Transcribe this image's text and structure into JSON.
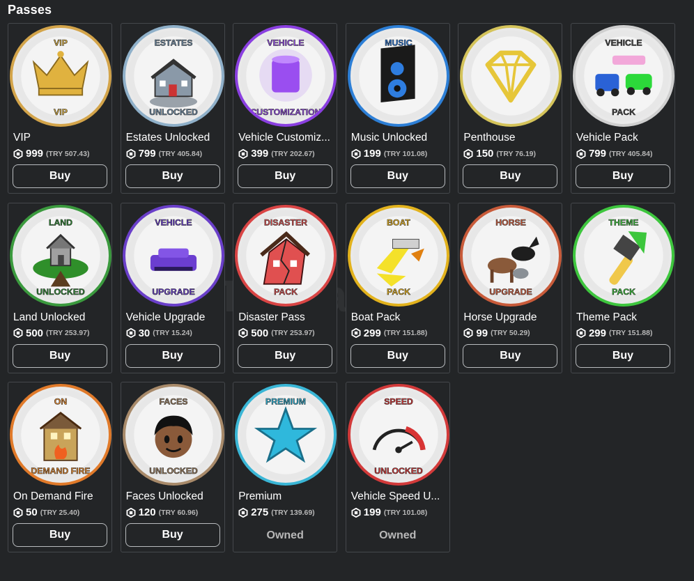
{
  "header": {
    "title": "Passes"
  },
  "watermark": "Tenyaa",
  "passes": [
    {
      "name": "VIP",
      "price": "999",
      "try": "(TRY 507.43)",
      "action": "Buy",
      "icon": "crown-icon",
      "banner_top": "VIP",
      "banner_bottom": "VIP",
      "ring": "#d3a44a",
      "color": "#e0b23f"
    },
    {
      "name": "Estates Unlocked",
      "price": "799",
      "try": "(TRY 405.84)",
      "action": "Buy",
      "icon": "house-icon",
      "banner_top": "ESTATES",
      "banner_bottom": "UNLOCKED",
      "ring": "#8fb0c9",
      "color": "#6f8ca6"
    },
    {
      "name": "Vehicle Customiz...",
      "price": "399",
      "try": "(TRY 202.67)",
      "action": "Buy",
      "icon": "paint-can-icon",
      "banner_top": "VEHICLE",
      "banner_bottom": "CUSTOMIZATION",
      "ring": "#8a3fe0",
      "color": "#9b4ef0"
    },
    {
      "name": "Music Unlocked",
      "price": "199",
      "try": "(TRY 101.08)",
      "action": "Buy",
      "icon": "speaker-icon",
      "banner_top": "MUSIC",
      "banner_bottom": "",
      "ring": "#2d7fd6",
      "color": "#2e7de0"
    },
    {
      "name": "Penthouse",
      "price": "150",
      "try": "(TRY 76.19)",
      "action": "Buy",
      "icon": "diamond-icon",
      "banner_top": "",
      "banner_bottom": "",
      "ring": "#d4c35a",
      "color": "#e6c639"
    },
    {
      "name": "Vehicle Pack",
      "price": "799",
      "try": "(TRY 405.84)",
      "action": "Buy",
      "icon": "cars-icon",
      "banner_top": "VEHICLE",
      "banner_bottom": "PACK",
      "ring": "#cfcfcf",
      "color": "#444444"
    },
    {
      "name": "Land Unlocked",
      "price": "500",
      "try": "(TRY 253.97)",
      "action": "Buy",
      "icon": "island-house-icon",
      "banner_top": "LAND",
      "banner_bottom": "UNLOCKED",
      "ring": "#3b9a3e",
      "color": "#2f8a34"
    },
    {
      "name": "Vehicle Upgrade",
      "price": "30",
      "try": "(TRY 15.24)",
      "action": "Buy",
      "icon": "car-upgrade-icon",
      "banner_top": "VEHICLE",
      "banner_bottom": "UPGRADE",
      "ring": "#6a3fc9",
      "color": "#6b3ed0"
    },
    {
      "name": "Disaster Pass",
      "price": "500",
      "try": "(TRY 253.97)",
      "action": "Buy",
      "icon": "broken-house-icon",
      "banner_top": "DISASTER",
      "banner_bottom": "PACK",
      "ring": "#d94545",
      "color": "#e05050"
    },
    {
      "name": "Boat Pack",
      "price": "299",
      "try": "(TRY 151.88)",
      "action": "Buy",
      "icon": "boat-icon",
      "banner_top": "BOAT",
      "banner_bottom": "PACK",
      "ring": "#e2b21d",
      "color": "#f0b81e"
    },
    {
      "name": "Horse Upgrade",
      "price": "99",
      "try": "(TRY 50.29)",
      "action": "Buy",
      "icon": "horse-icon",
      "banner_top": "HORSE",
      "banner_bottom": "UPGRADE",
      "ring": "#c85b3a",
      "color": "#d46040"
    },
    {
      "name": "Theme Pack",
      "price": "299",
      "try": "(TRY 151.88)",
      "action": "Buy",
      "icon": "paintbrush-icon",
      "banner_top": "THEME",
      "banner_bottom": "PACK",
      "ring": "#3ec63e",
      "color": "#3cc63c"
    },
    {
      "name": "On Demand Fire",
      "price": "50",
      "try": "(TRY 25.40)",
      "action": "Buy",
      "icon": "fire-house-icon",
      "banner_top": "ON",
      "banner_bottom": "DEMAND FIRE",
      "ring": "#e07a2a",
      "color": "#e98a2c"
    },
    {
      "name": "Faces Unlocked",
      "price": "120",
      "try": "(TRY 60.96)",
      "action": "Buy",
      "icon": "face-icon",
      "banner_top": "FACES",
      "banner_bottom": "UNLOCKED",
      "ring": "#a88a6a",
      "color": "#9b7d5e"
    },
    {
      "name": "Premium",
      "price": "275",
      "try": "(TRY 139.69)",
      "action": "Owned",
      "icon": "star-icon",
      "banner_top": "PREMIUM",
      "banner_bottom": "",
      "ring": "#3ab6d6",
      "color": "#2fb8dc"
    },
    {
      "name": "Vehicle Speed U...",
      "price": "199",
      "try": "(TRY 101.08)",
      "action": "Owned",
      "icon": "speedometer-icon",
      "banner_top": "SPEED",
      "banner_bottom": "UNLOCKED",
      "ring": "#d23a3a",
      "color": "#d83434"
    }
  ]
}
